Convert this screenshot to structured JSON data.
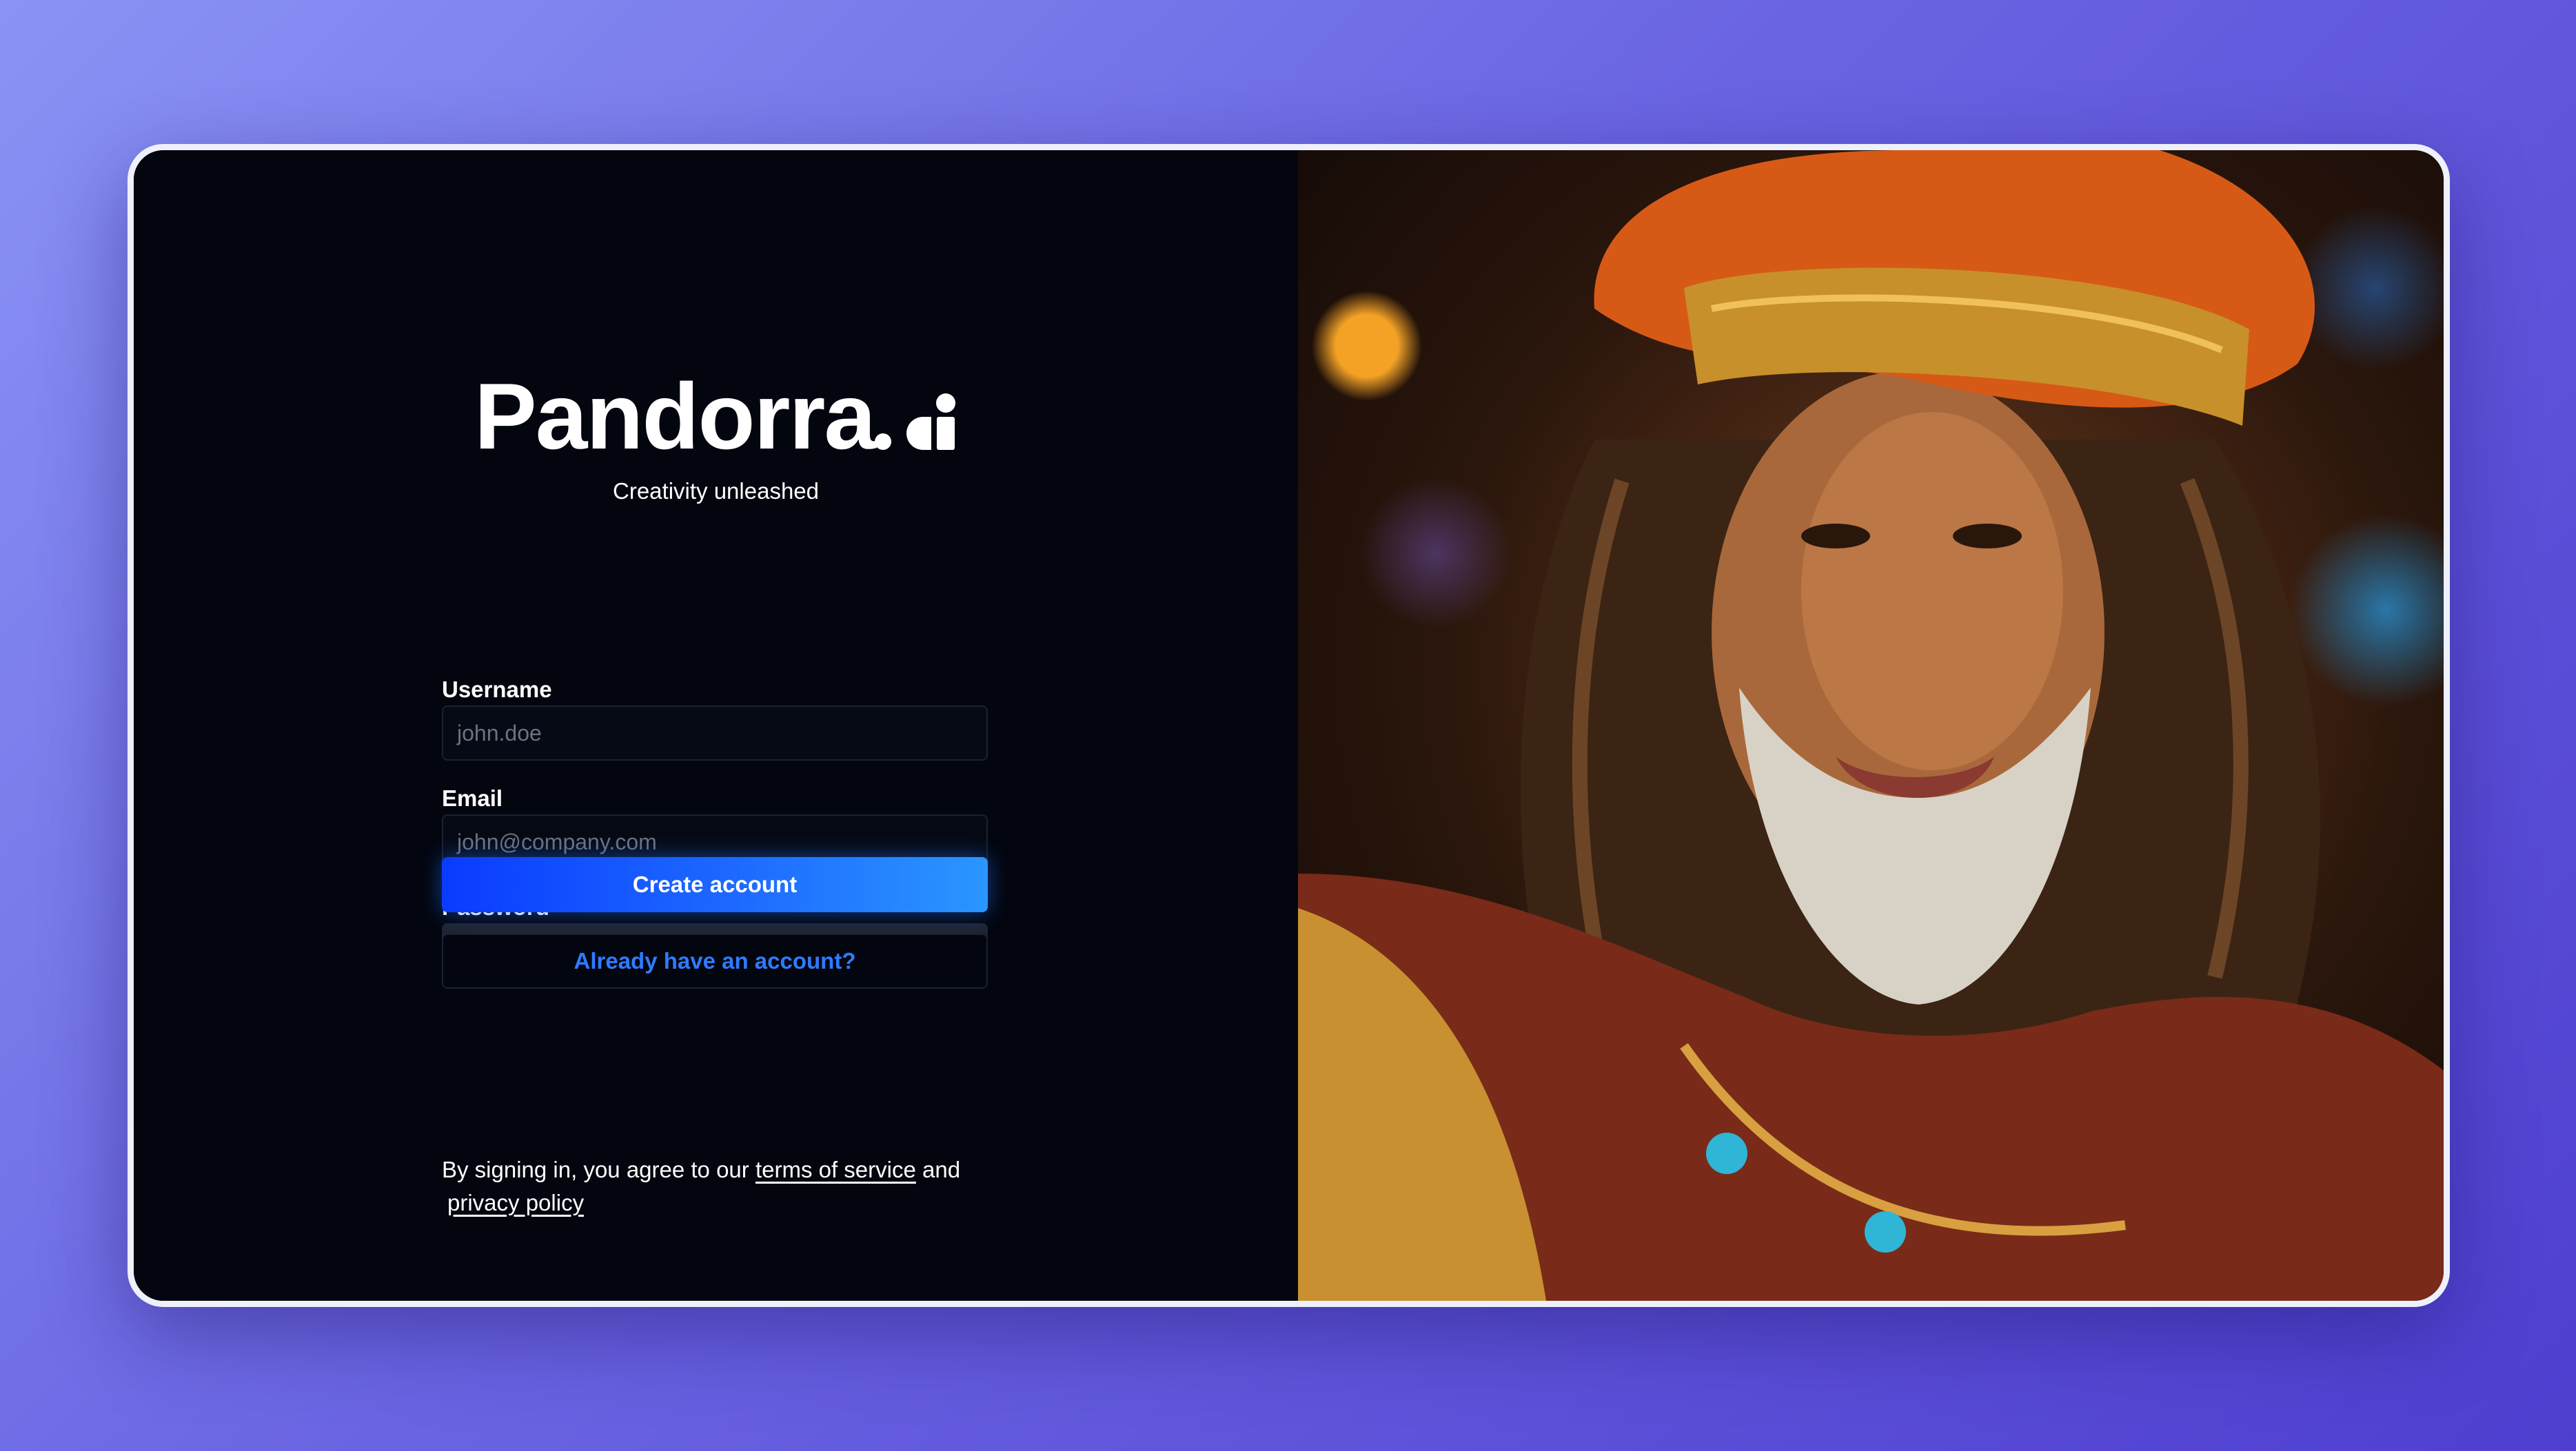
{
  "brand": {
    "name": "Pandorra",
    "suffix": ".ai",
    "tagline": "Creativity unleashed"
  },
  "form": {
    "username": {
      "label": "Username",
      "placeholder": "john.doe",
      "value": ""
    },
    "email": {
      "label": "Email",
      "placeholder": "john@company.com",
      "value": ""
    },
    "password": {
      "label": "Password",
      "value": "•••••••••••••",
      "toggle_icon": "eye-icon"
    },
    "submit_label": "Create account",
    "signin_label": "Already have an account?"
  },
  "legal": {
    "prefix": "By signing in, you agree to our",
    "terms_label": "terms of service",
    "joiner": "and",
    "privacy_label": "privacy policy"
  },
  "colors": {
    "accent": "#1e6bff",
    "panel": "#03060f",
    "link": "#2f7bff"
  },
  "hero_image": {
    "description_icon": "portrait-image"
  }
}
